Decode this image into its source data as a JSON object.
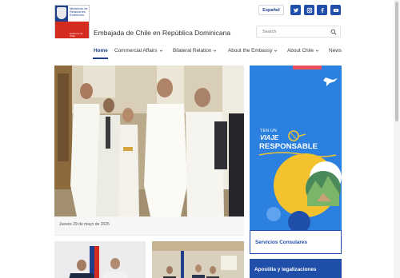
{
  "header": {
    "logo_line1": "Ministerio de Relaciones Exteriores",
    "logo_line2": "Gobierno de Chile",
    "site_title": "Embajada de Chile en República Dominicana",
    "language_button": "Español",
    "social_icons": [
      "twitter-icon",
      "instagram-icon",
      "facebook-icon",
      "youtube-icon"
    ],
    "search": {
      "placeholder": "Search"
    }
  },
  "nav": {
    "items": [
      {
        "label": "Home",
        "active": true,
        "dropdown": false
      },
      {
        "label": "Commercial Affairs",
        "active": false,
        "dropdown": true
      },
      {
        "label": "Bilateral Relation",
        "active": false,
        "dropdown": true
      },
      {
        "label": "About the Embassy",
        "active": false,
        "dropdown": true
      },
      {
        "label": "About Chile",
        "active": false,
        "dropdown": true
      },
      {
        "label": "News",
        "active": false,
        "dropdown": false
      }
    ]
  },
  "main": {
    "hero_caption": "Jueves 29 de mayo de 2025"
  },
  "banner": {
    "line1": "TEN UN",
    "line2": "VIAJE",
    "line3": "RESPONSABLE"
  },
  "sidebar": {
    "links": [
      "Servicios Consulares",
      "Apostilla y legalizaciones"
    ]
  },
  "colors": {
    "brand_blue": "#1f4fa8",
    "chile_red": "#d52b1e",
    "nav_active": "#1f3e8c",
    "banner_blue": "#2c80e0",
    "banner_yellow": "#f5c22f"
  }
}
